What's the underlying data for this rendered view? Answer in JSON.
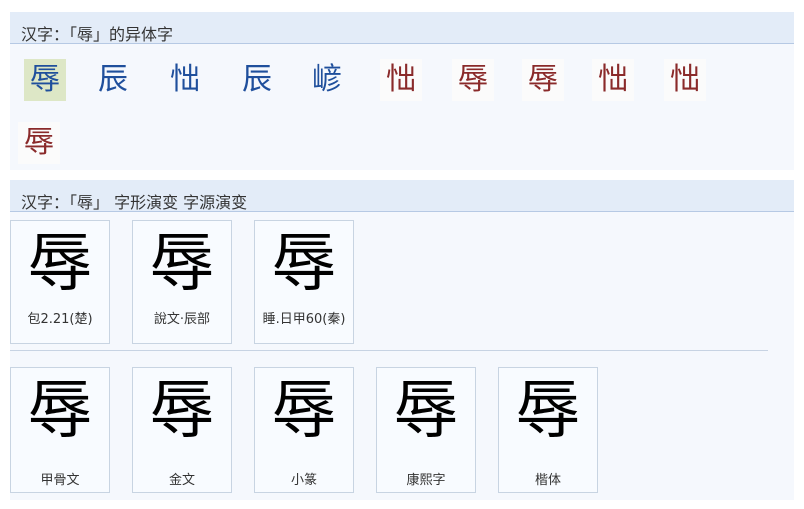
{
  "variants_section": {
    "header": "汉字：「辱」的异体字",
    "glyphs": [
      "辱",
      "辰",
      "㤕",
      "辰",
      "嵃",
      "㤕",
      "辱",
      "辱",
      "㤕",
      "㤕",
      "辱"
    ]
  },
  "evolution_section": {
    "header": "汉字：「辱」 字形演变 字源演变",
    "row1": [
      {
        "glyph": "辱",
        "caption": "包2.21(楚)"
      },
      {
        "glyph": "辱",
        "caption": "說文‧辰部"
      },
      {
        "glyph": "辱",
        "caption": "睡.日甲60(秦)"
      }
    ],
    "row2": [
      {
        "glyph": "辱",
        "caption": "甲骨文"
      },
      {
        "glyph": "辱",
        "caption": "金文"
      },
      {
        "glyph": "辱",
        "caption": "小篆"
      },
      {
        "glyph": "辱",
        "caption": "康熙字"
      },
      {
        "glyph": "辱",
        "caption": "楷体"
      }
    ]
  }
}
